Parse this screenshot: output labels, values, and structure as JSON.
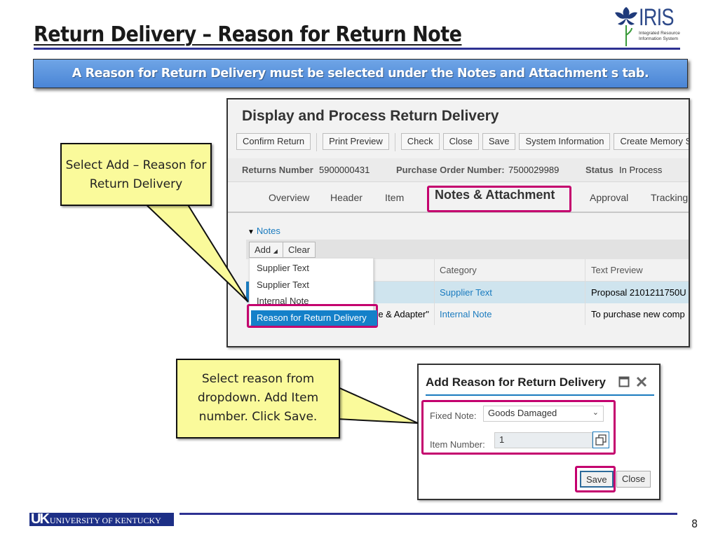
{
  "slide": {
    "title": "Return Delivery – Reason for Return Note",
    "banner": "A Reason for Return Delivery must be selected under the Notes and Attachment s tab.",
    "page_number": "8",
    "accent_color": "#2e3192",
    "highlight_color": "#c4006e"
  },
  "logos": {
    "iris_word": "IRIS",
    "iris_sub_line1": "Integrated Resource",
    "iris_sub_line2": "Information System",
    "uk_initials": "UK",
    "uk_name": "UNIVERSITY OF KENTUCKY"
  },
  "callouts": {
    "first": "Select Add – Reason for Return Delivery",
    "second": "Select reason from dropdown. Add Item number. Click Save."
  },
  "sap": {
    "title": "Display and Process Return Delivery",
    "toolbar": [
      "Confirm Return",
      "Print Preview",
      "Check",
      "Close",
      "Save",
      "System Information",
      "Create Memory Sn"
    ],
    "info": {
      "returns_label": "Returns Number",
      "returns_value": "5900000431",
      "po_label": "Purchase Order Number:",
      "po_value": "7500029989",
      "status_label": "Status",
      "status_value": "In Process"
    },
    "tabs": [
      "Overview",
      "Header",
      "Item",
      "Notes & Attachment",
      "Approval",
      "Tracking"
    ],
    "active_tab": "Notes & Attachment",
    "notes": {
      "section_label": "Notes",
      "add_button": "Add",
      "clear_button": "Clear",
      "dropdown": [
        "Supplier Text",
        "Supplier Text",
        "Internal Note",
        "Reason for Return Delivery"
      ],
      "columns": [
        "Category",
        "Text Preview"
      ],
      "rows": [
        {
          "title": "",
          "category": "Supplier Text",
          "preview": "Proposal 2101211750U"
        },
        {
          "title": "re & Adapter\"",
          "category": "Internal Note",
          "preview": "To purchase new comp"
        }
      ]
    }
  },
  "dialog": {
    "title": "Add Reason for Return Delivery",
    "fixed_note_label": "Fixed Note:",
    "fixed_note_value": "Goods Damaged",
    "item_number_label": "Item Number:",
    "item_number_value": "1",
    "save_button": "Save",
    "close_button": "Close"
  }
}
